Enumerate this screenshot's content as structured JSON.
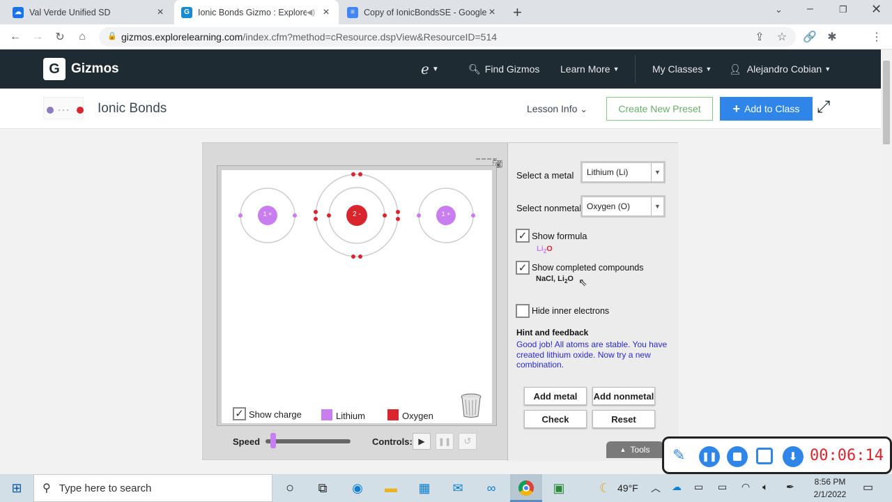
{
  "browser": {
    "tabs": [
      {
        "title": "Val Verde Unified SD",
        "icon": "cloud-icon"
      },
      {
        "title": "Ionic Bonds Gizmo : ExploreL",
        "icon": "gizmos-icon",
        "active": true
      },
      {
        "title": "Copy of IonicBondsSE - Google [",
        "icon": "docs-icon"
      }
    ],
    "url_host": "gizmos.explorelearning.com",
    "url_path": "/index.cfm?method=cResource.dspView&ResourceID=514"
  },
  "gizmos_nav": {
    "logo_letter": "G",
    "logo_text": "Gizmos",
    "find": "Find Gizmos",
    "learn_more": "Learn More",
    "my_classes": "My Classes",
    "user": "Alejandro Cobian"
  },
  "subheader": {
    "title": "Ionic Bonds",
    "lesson_info": "Lesson Info",
    "create_preset": "Create New Preset",
    "add_to_class": "Add to Class"
  },
  "gizmo": {
    "atoms": [
      {
        "label": "1 +",
        "kind": "metal"
      },
      {
        "label": "2 -",
        "kind": "nonmetal"
      },
      {
        "label": "1 +",
        "kind": "metal"
      }
    ],
    "show_charge": "Show charge",
    "legend": [
      {
        "label": "Lithium",
        "color": "#c97ef0"
      },
      {
        "label": "Oxygen",
        "color": "#d9262e"
      }
    ],
    "speed_label": "Speed",
    "controls_label": "Controls:",
    "select_metal_label": "Select a metal",
    "select_metal_value": "Lithium (Li)",
    "select_nonmetal_label": "Select nonmetal",
    "select_nonmetal_value": "Oxygen (O)",
    "show_formula": "Show formula",
    "formula_main": "Li",
    "formula_sub": "2",
    "formula_end": "O",
    "show_completed": "Show completed compounds",
    "completed_a": "NaCl, Li",
    "completed_sub": "2",
    "completed_end": "O",
    "hide_inner": "Hide inner electrons",
    "hint_title": "Hint and feedback",
    "hint_text": "Good job! All atoms are stable. You have created lithium oxide. Now try a new combination.",
    "add_metal": "Add metal",
    "add_nonmetal": "Add nonmetal",
    "check": "Check",
    "reset": "Reset",
    "tools": "Tools"
  },
  "recorder": {
    "time": "00:06:14"
  },
  "taskbar": {
    "search_placeholder": "Type here to search",
    "weather": "49°F",
    "time": "8:56 PM",
    "date": "2/1/2022"
  },
  "colors": {
    "lithium": "#c97ef0",
    "oxygen": "#d9262e",
    "accent": "#2f86e8",
    "nav_bg": "#1f2b33"
  }
}
